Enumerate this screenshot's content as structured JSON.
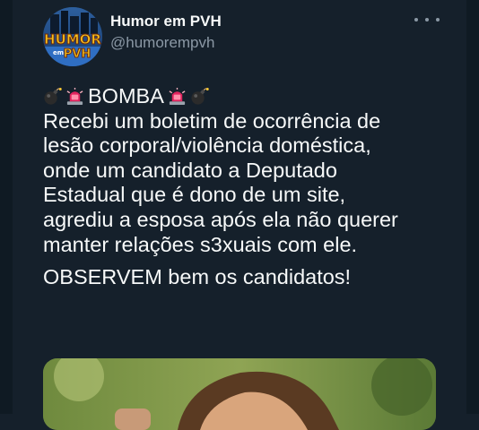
{
  "tweet": {
    "author_name": "Humor em PVH",
    "author_handle": "@humorempvh",
    "headline": "BOMBA",
    "body_lines": [
      "Recebi um boletim de ocorrência de",
      "lesão corporal/violência doméstica,",
      "onde um candidato a Deputado",
      "Estadual que é dono de um site,",
      "agrediu a esposa após ela não querer",
      "manter relações s3xuais com ele."
    ],
    "closing": "OBSERVEM bem os candidatos!"
  },
  "avatar": {
    "logo_text_line1": "HUMOR",
    "logo_text_line2": "PVH",
    "logo_text_small": "em"
  },
  "icons": [
    "bomb-icon",
    "police-light-icon",
    "more-options-icon"
  ],
  "colors": {
    "background": "#15202b",
    "text": "#f7f9f9",
    "secondary_text": "#8b98a5"
  }
}
